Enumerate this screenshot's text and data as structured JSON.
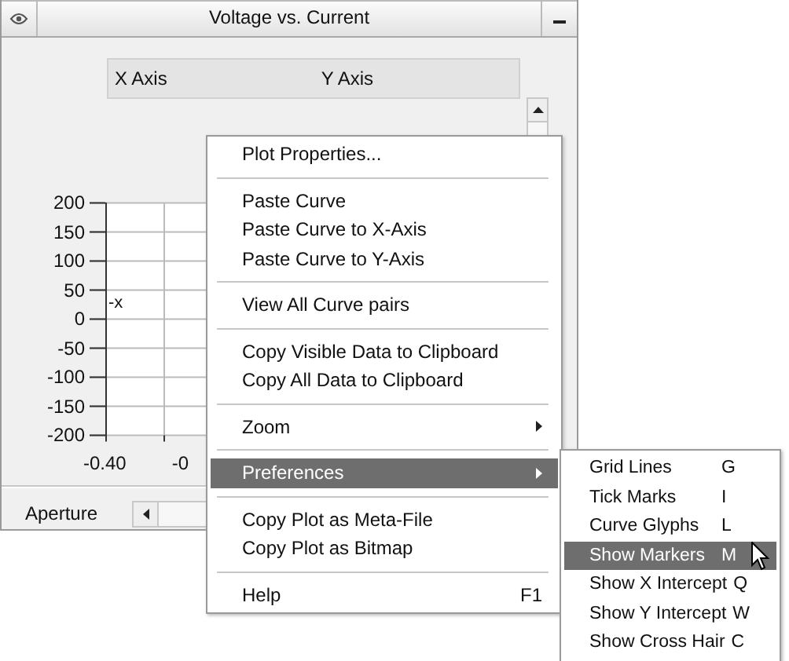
{
  "window": {
    "title": "Voltage vs. Current"
  },
  "axis_header": {
    "x_label": "X Axis",
    "y_label": "Y Axis"
  },
  "plot": {
    "y_ticks": [
      "200",
      "150",
      "100",
      "50",
      "0",
      "-50",
      "-100",
      "-150",
      "-200"
    ],
    "x_ticks": [
      "-0.40",
      "-0"
    ],
    "marker": "-x"
  },
  "slider": {
    "label": "Aperture"
  },
  "context_menu": {
    "items": [
      {
        "kind": "item",
        "label": "Plot Properties...",
        "selected": false
      },
      {
        "kind": "separator"
      },
      {
        "kind": "item",
        "label": "Paste Curve",
        "selected": false
      },
      {
        "kind": "item",
        "label": "Paste Curve to X-Axis",
        "selected": false
      },
      {
        "kind": "item",
        "label": "Paste Curve to Y-Axis",
        "selected": false
      },
      {
        "kind": "separator"
      },
      {
        "kind": "item",
        "label": "View All Curve pairs",
        "selected": false
      },
      {
        "kind": "separator"
      },
      {
        "kind": "item",
        "label": "Copy Visible Data to Clipboard",
        "selected": false
      },
      {
        "kind": "item",
        "label": "Copy All Data to Clipboard",
        "selected": false
      },
      {
        "kind": "separator"
      },
      {
        "kind": "submenu",
        "label": "Zoom",
        "selected": false
      },
      {
        "kind": "separator"
      },
      {
        "kind": "submenu",
        "label": "Preferences",
        "selected": true
      },
      {
        "kind": "separator"
      },
      {
        "kind": "item",
        "label": "Copy Plot as Meta-File",
        "selected": false
      },
      {
        "kind": "item",
        "label": "Copy Plot as Bitmap",
        "selected": false
      },
      {
        "kind": "separator"
      },
      {
        "kind": "item",
        "label": "Help",
        "shortcut": "F1",
        "selected": false
      }
    ]
  },
  "submenu": {
    "items": [
      {
        "kind": "item",
        "label": "Grid Lines",
        "shortcut": "G",
        "selected": false
      },
      {
        "kind": "item",
        "label": "Tick Marks",
        "shortcut": "I",
        "selected": false
      },
      {
        "kind": "item",
        "label": "Curve Glyphs",
        "shortcut": "L",
        "selected": false
      },
      {
        "kind": "item",
        "label": "Show Markers",
        "shortcut": "M",
        "selected": true
      },
      {
        "kind": "item",
        "label": "Show X Intercept",
        "shortcut": "Q",
        "selected": false
      },
      {
        "kind": "item",
        "label": "Show Y Intercept",
        "shortcut": "W",
        "selected": false
      },
      {
        "kind": "item",
        "label": "Show Cross Hair",
        "shortcut": "C",
        "selected": false
      }
    ]
  }
}
